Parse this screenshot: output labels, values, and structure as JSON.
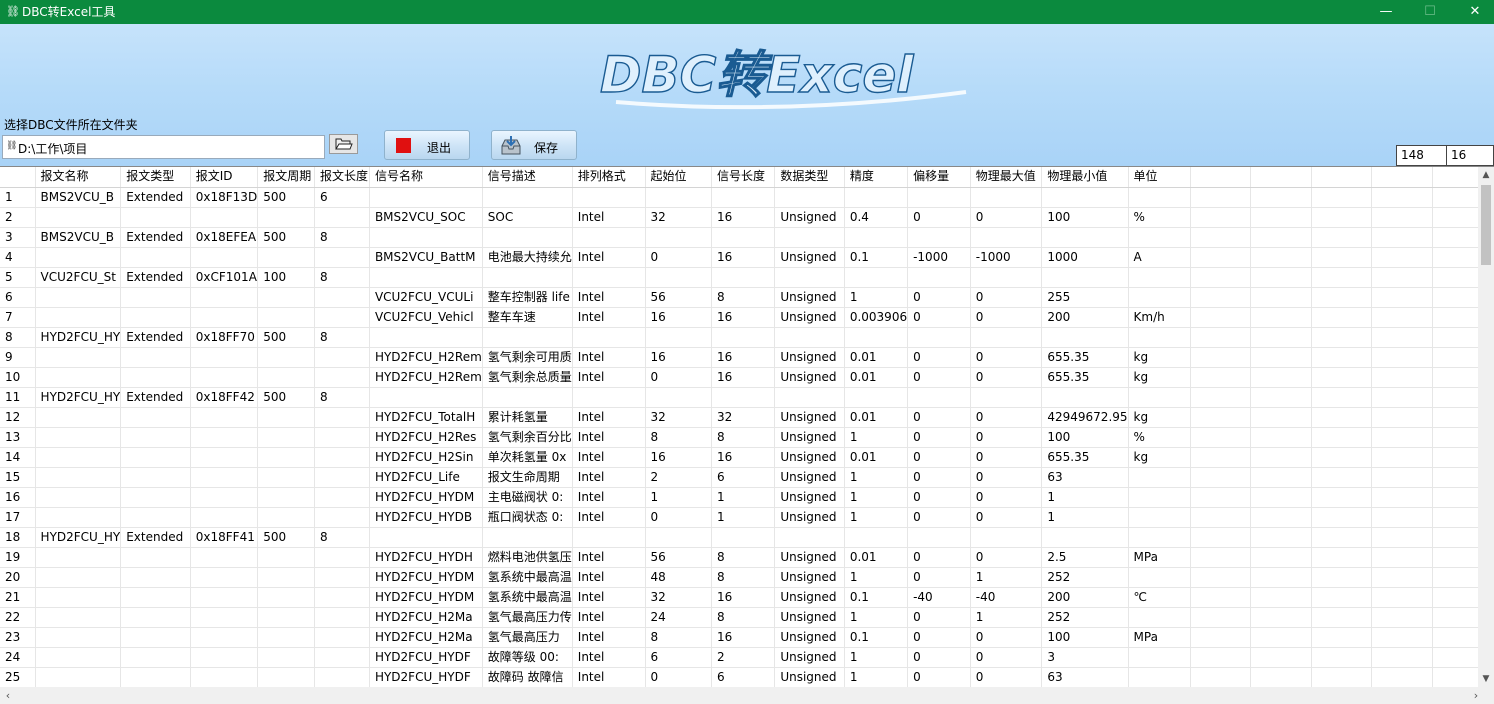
{
  "window": {
    "title": "DBC转Excel工具",
    "controls": {
      "minimize": "—",
      "maximize": "☐",
      "close": "✕"
    }
  },
  "header": {
    "logo_text": "DBC转Excel",
    "folder_label": "选择DBC文件所在文件夹",
    "folder_path": "D:\\工作\\项目",
    "browse_icon": "folder-open-icon",
    "exit_label": "退出",
    "save_label": "保存",
    "counter_rows": "148",
    "counter_cols": "16",
    "colors": {
      "titlebar": "#0b8a3e",
      "header_bg": "#b6dbf9",
      "exit_square": "#e01010"
    }
  },
  "grid": {
    "columns": [
      "",
      "报文名称",
      "报文类型",
      "报文ID",
      "报文周期",
      "报文长度",
      "信号名称",
      "信号描述",
      "排列格式",
      "起始位",
      "信号长度",
      "数据类型",
      "精度",
      "偏移量",
      "物理最大值",
      "物理最小值",
      "单位",
      "",
      "",
      "",
      "",
      ""
    ],
    "rows": [
      [
        "1",
        "BMS2VCU_B",
        "Extended",
        "0x18F13D",
        "500",
        "6",
        "",
        "",
        "",
        "",
        "",
        "",
        "",
        "",
        "",
        "",
        "",
        "",
        "",
        "",
        "",
        ""
      ],
      [
        "2",
        "",
        "",
        "",
        "",
        "",
        "BMS2VCU_SOC",
        "SOC",
        "Intel",
        "32",
        "16",
        "Unsigned",
        "0.4",
        "0",
        "0",
        "100",
        "%",
        "",
        "",
        "",
        "",
        ""
      ],
      [
        "3",
        "BMS2VCU_B",
        "Extended",
        "0x18EFEA",
        "500",
        "8",
        "",
        "",
        "",
        "",
        "",
        "",
        "",
        "",
        "",
        "",
        "",
        "",
        "",
        "",
        "",
        ""
      ],
      [
        "4",
        "",
        "",
        "",
        "",
        "",
        "BMS2VCU_BattM",
        "电池最大持续允",
        "Intel",
        "0",
        "16",
        "Unsigned",
        "0.1",
        "-1000",
        "-1000",
        "1000",
        "A",
        "",
        "",
        "",
        "",
        ""
      ],
      [
        "5",
        "VCU2FCU_St",
        "Extended",
        "0xCF101A",
        "100",
        "8",
        "",
        "",
        "",
        "",
        "",
        "",
        "",
        "",
        "",
        "",
        "",
        "",
        "",
        "",
        "",
        ""
      ],
      [
        "6",
        "",
        "",
        "",
        "",
        "",
        "VCU2FCU_VCULi",
        "整车控制器 life",
        "Intel",
        "56",
        "8",
        "Unsigned",
        "1",
        "0",
        "0",
        "255",
        "",
        "",
        "",
        "",
        "",
        ""
      ],
      [
        "7",
        "",
        "",
        "",
        "",
        "",
        "VCU2FCU_Vehicl",
        "整车车速",
        "Intel",
        "16",
        "16",
        "Unsigned",
        "0.003906",
        "0",
        "0",
        "200",
        "Km/h",
        "",
        "",
        "",
        "",
        ""
      ],
      [
        "8",
        "HYD2FCU_HY",
        "Extended",
        "0x18FF70",
        "500",
        "8",
        "",
        "",
        "",
        "",
        "",
        "",
        "",
        "",
        "",
        "",
        "",
        "",
        "",
        "",
        "",
        ""
      ],
      [
        "9",
        "",
        "",
        "",
        "",
        "",
        "HYD2FCU_H2Rem",
        "氢气剩余可用质",
        "Intel",
        "16",
        "16",
        "Unsigned",
        "0.01",
        "0",
        "0",
        "655.35",
        "kg",
        "",
        "",
        "",
        "",
        ""
      ],
      [
        "10",
        "",
        "",
        "",
        "",
        "",
        "HYD2FCU_H2Rem",
        "氢气剩余总质量",
        "Intel",
        "0",
        "16",
        "Unsigned",
        "0.01",
        "0",
        "0",
        "655.35",
        "kg",
        "",
        "",
        "",
        "",
        ""
      ],
      [
        "11",
        "HYD2FCU_HY",
        "Extended",
        "0x18FF42",
        "500",
        "8",
        "",
        "",
        "",
        "",
        "",
        "",
        "",
        "",
        "",
        "",
        "",
        "",
        "",
        "",
        "",
        ""
      ],
      [
        "12",
        "",
        "",
        "",
        "",
        "",
        "HYD2FCU_TotalH",
        "累计耗氢量",
        "Intel",
        "32",
        "32",
        "Unsigned",
        "0.01",
        "0",
        "0",
        "42949672.95",
        "kg",
        "",
        "",
        "",
        "",
        ""
      ],
      [
        "13",
        "",
        "",
        "",
        "",
        "",
        "HYD2FCU_H2Res",
        "氢气剩余百分比",
        "Intel",
        "8",
        "8",
        "Unsigned",
        "1",
        "0",
        "0",
        "100",
        "%",
        "",
        "",
        "",
        "",
        ""
      ],
      [
        "14",
        "",
        "",
        "",
        "",
        "",
        "HYD2FCU_H2Sin",
        "单次耗氢量 0x",
        "Intel",
        "16",
        "16",
        "Unsigned",
        "0.01",
        "0",
        "0",
        "655.35",
        "kg",
        "",
        "",
        "",
        "",
        ""
      ],
      [
        "15",
        "",
        "",
        "",
        "",
        "",
        "HYD2FCU_Life",
        "报文生命周期",
        "Intel",
        "2",
        "6",
        "Unsigned",
        "1",
        "0",
        "0",
        "63",
        "",
        "",
        "",
        "",
        "",
        ""
      ],
      [
        "16",
        "",
        "",
        "",
        "",
        "",
        "HYD2FCU_HYDM",
        "主电磁阀状 0:",
        "Intel",
        "1",
        "1",
        "Unsigned",
        "1",
        "0",
        "0",
        "1",
        "",
        "",
        "",
        "",
        "",
        ""
      ],
      [
        "17",
        "",
        "",
        "",
        "",
        "",
        "HYD2FCU_HYDB",
        "瓶口阀状态 0:",
        "Intel",
        "0",
        "1",
        "Unsigned",
        "1",
        "0",
        "0",
        "1",
        "",
        "",
        "",
        "",
        "",
        ""
      ],
      [
        "18",
        "HYD2FCU_HY",
        "Extended",
        "0x18FF41",
        "500",
        "8",
        "",
        "",
        "",
        "",
        "",
        "",
        "",
        "",
        "",
        "",
        "",
        "",
        "",
        "",
        "",
        ""
      ],
      [
        "19",
        "",
        "",
        "",
        "",
        "",
        "HYD2FCU_HYDH",
        "燃料电池供氢压",
        "Intel",
        "56",
        "8",
        "Unsigned",
        "0.01",
        "0",
        "0",
        "2.5",
        "MPa",
        "",
        "",
        "",
        "",
        ""
      ],
      [
        "20",
        "",
        "",
        "",
        "",
        "",
        "HYD2FCU_HYDM",
        "氢系统中最高温",
        "Intel",
        "48",
        "8",
        "Unsigned",
        "1",
        "0",
        "1",
        "252",
        "",
        "",
        "",
        "",
        "",
        ""
      ],
      [
        "21",
        "",
        "",
        "",
        "",
        "",
        "HYD2FCU_HYDM",
        "氢系统中最高温",
        "Intel",
        "32",
        "16",
        "Unsigned",
        "0.1",
        "-40",
        "-40",
        "200",
        "℃",
        "",
        "",
        "",
        "",
        ""
      ],
      [
        "22",
        "",
        "",
        "",
        "",
        "",
        "HYD2FCU_H2Ma",
        "氢气最高压力传",
        "Intel",
        "24",
        "8",
        "Unsigned",
        "1",
        "0",
        "1",
        "252",
        "",
        "",
        "",
        "",
        "",
        ""
      ],
      [
        "23",
        "",
        "",
        "",
        "",
        "",
        "HYD2FCU_H2Ma",
        "氢气最高压力",
        "Intel",
        "8",
        "16",
        "Unsigned",
        "0.1",
        "0",
        "0",
        "100",
        "MPa",
        "",
        "",
        "",
        "",
        ""
      ],
      [
        "24",
        "",
        "",
        "",
        "",
        "",
        "HYD2FCU_HYDF",
        "故障等级 00:",
        "Intel",
        "6",
        "2",
        "Unsigned",
        "1",
        "0",
        "0",
        "3",
        "",
        "",
        "",
        "",
        "",
        ""
      ],
      [
        "25",
        "",
        "",
        "",
        "",
        "",
        "HYD2FCU_HYDF",
        "故障码 故障信",
        "Intel",
        "0",
        "6",
        "Unsigned",
        "1",
        "0",
        "0",
        "63",
        "",
        "",
        "",
        "",
        "",
        ""
      ]
    ]
  }
}
